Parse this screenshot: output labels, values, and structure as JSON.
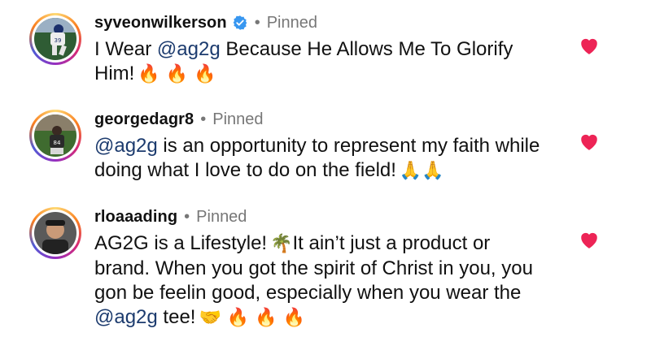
{
  "colors": {
    "heart": "#ed2456",
    "mention": "#1c3b6e",
    "verified": "#3897f0",
    "muted": "#777777"
  },
  "comments": [
    {
      "username": "syveonwilkerson",
      "verified": true,
      "dot": "•",
      "pinned": "Pinned",
      "text_parts": [
        "I Wear ",
        "@ag2g",
        " Because He Allows Me To Glorify Him!"
      ],
      "emojis": "🔥 🔥 🔥",
      "liked": true
    },
    {
      "username": "georgedagr8",
      "verified": false,
      "dot": "•",
      "pinned": "Pinned",
      "text_parts": [
        "@ag2g",
        " is an opportunity to represent my faith while doing what I love to do on the field!"
      ],
      "emojis": "🙏🙏",
      "liked": true
    },
    {
      "username": "rloaaading",
      "verified": false,
      "dot": "•",
      "pinned": "Pinned",
      "text_parts": [
        "AG2G is a Lifestyle!",
        "🌴",
        "It ain’t just a product or brand. When you got the spirit of Christ in you, you gon be feelin good, especially when you wear the ",
        "@ag2g",
        " tee!"
      ],
      "emojis": "🤝 🔥 🔥 🔥",
      "liked": true
    }
  ]
}
